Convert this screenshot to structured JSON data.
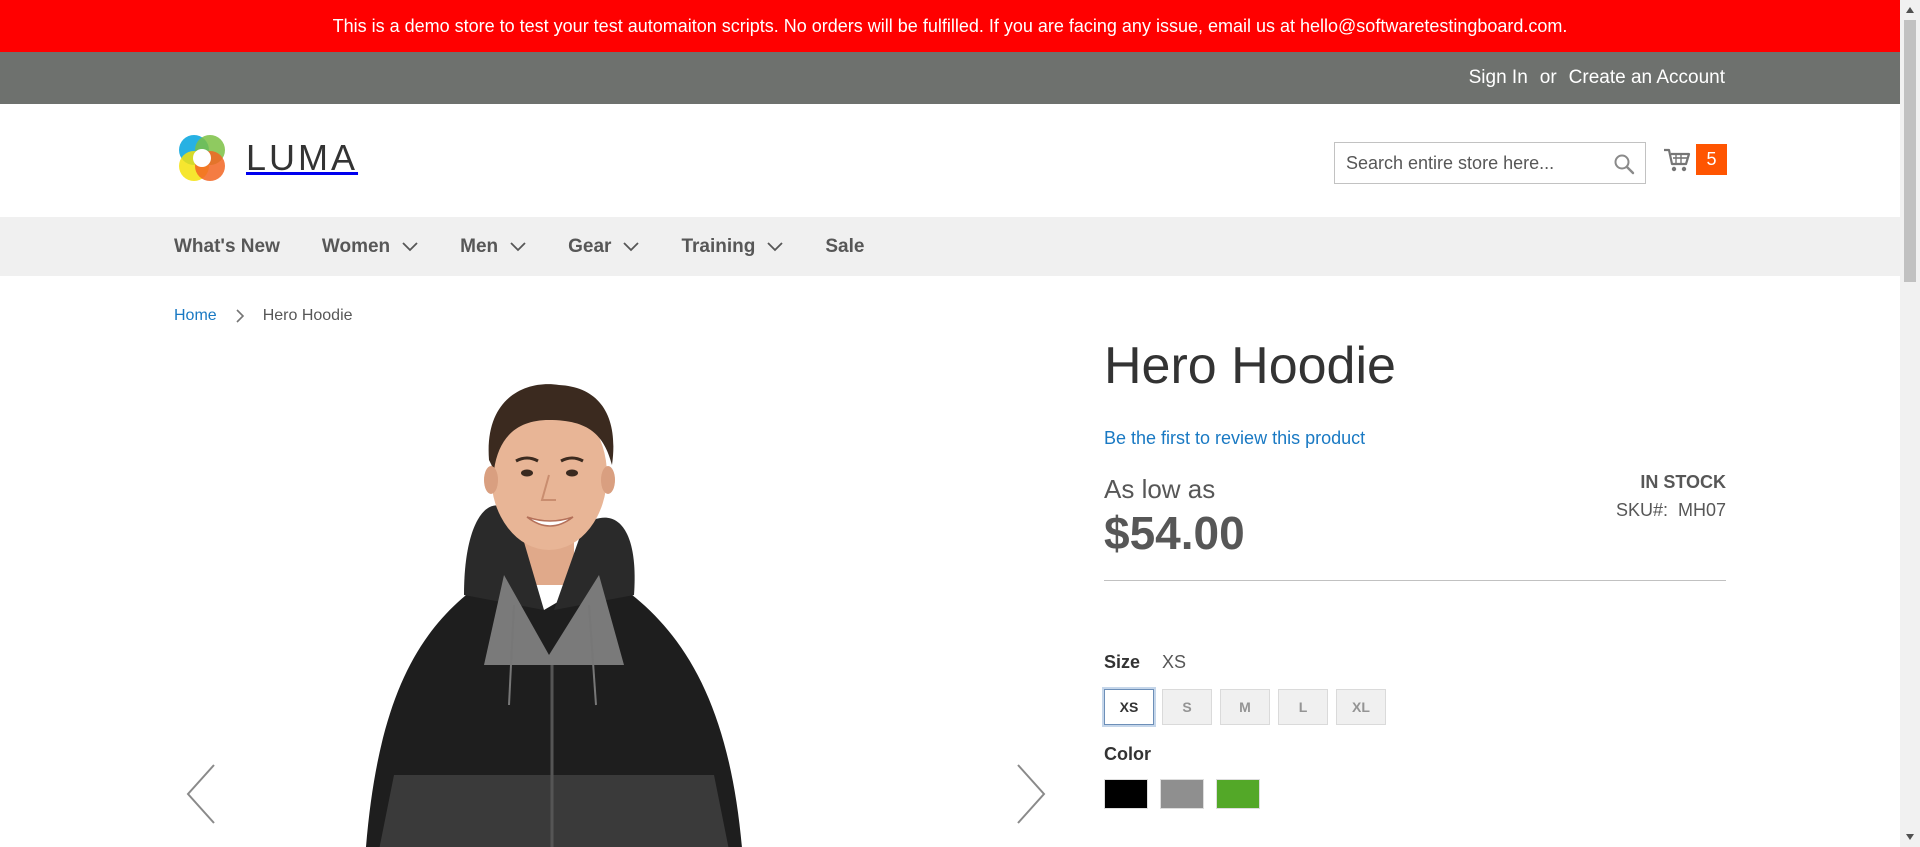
{
  "banner": {
    "text": "This is a demo store to test your test automaiton scripts. No orders will be fulfilled. If you are facing any issue, email us at hello@softwaretestingboard.com."
  },
  "header_links": {
    "sign_in": "Sign In",
    "or": "or",
    "create_account": "Create an Account"
  },
  "logo": {
    "text": "LUMA"
  },
  "search": {
    "placeholder": "Search entire store here..."
  },
  "minicart": {
    "count": "5"
  },
  "nav": {
    "items": [
      {
        "label": "What's New",
        "has_submenu": false
      },
      {
        "label": "Women",
        "has_submenu": true
      },
      {
        "label": "Men",
        "has_submenu": true
      },
      {
        "label": "Gear",
        "has_submenu": true
      },
      {
        "label": "Training",
        "has_submenu": true
      },
      {
        "label": "Sale",
        "has_submenu": false
      }
    ]
  },
  "breadcrumbs": {
    "home": "Home",
    "current": "Hero Hoodie"
  },
  "product": {
    "title": "Hero Hoodie",
    "review_link": "Be the first to review this product",
    "price_label": "As low as",
    "price": "$54.00",
    "stock": "IN STOCK",
    "sku_label": "SKU#:",
    "sku": "MH07"
  },
  "size": {
    "label": "Size",
    "selected": "XS",
    "options": [
      "XS",
      "S",
      "M",
      "L",
      "XL"
    ]
  },
  "color": {
    "label": "Color",
    "options": [
      {
        "name": "Black",
        "hex": "#000000"
      },
      {
        "name": "Gray",
        "hex": "#8f8f8f"
      },
      {
        "name": "Green",
        "hex": "#53a828"
      }
    ]
  },
  "colors": {
    "banner": "#ff0000",
    "header_bar": "#6e716e",
    "nav_bg": "#f0f0f0",
    "link": "#1979c3",
    "cart_badge": "#ff5501"
  }
}
